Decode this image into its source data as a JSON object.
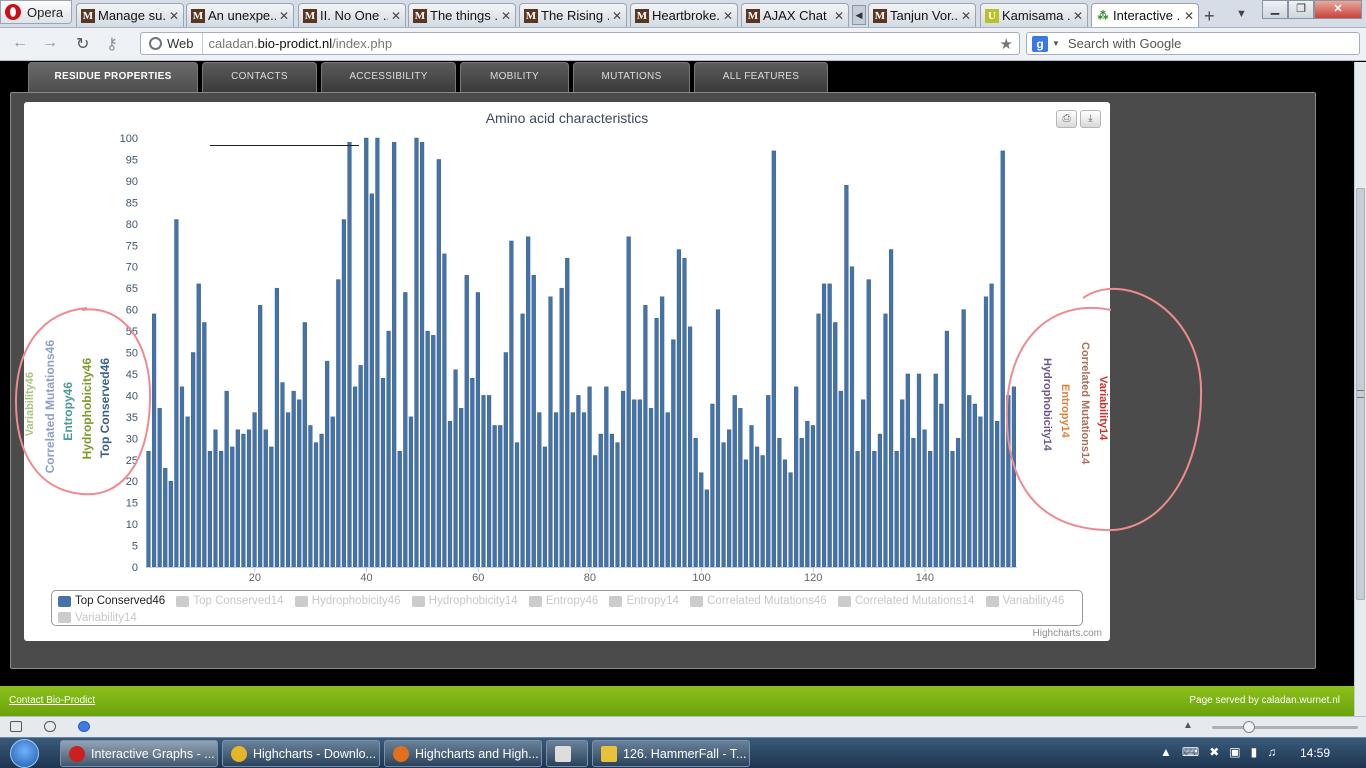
{
  "browser": {
    "opera_label": "Opera",
    "tabs": [
      {
        "title": "Manage su...",
        "icon": "m"
      },
      {
        "title": "An unexpe...",
        "icon": "m"
      },
      {
        "title": "II. No One ...",
        "icon": "m"
      },
      {
        "title": "The things ...",
        "icon": "m"
      },
      {
        "title": "The Rising ...",
        "icon": "m"
      },
      {
        "title": "Heartbroke...",
        "icon": "m"
      },
      {
        "title": "AJAX Chat",
        "icon": "m"
      },
      {
        "title": "Tanjun Vor...",
        "icon": "m"
      },
      {
        "title": "Kamisama ...",
        "icon": "u"
      },
      {
        "title": "Interactive ...",
        "icon": "g"
      }
    ],
    "web_label": "Web",
    "url_prefix": "caladan.",
    "url_domain": "bio-prodict.nl",
    "url_path": "/index.php",
    "search_placeholder": "Search with Google",
    "search_engine_letter": "g"
  },
  "nav_tabs": [
    "RESIDUE PROPERTIES",
    "CONTACTS",
    "ACCESSIBILITY",
    "MOBILITY",
    "MUTATIONS",
    "ALL FEATURES"
  ],
  "active_tab": "RESIDUE PROPERTIES",
  "chart_data": {
    "type": "bar",
    "title": "Amino acid characteristics",
    "xlabel": "",
    "ylabel": "",
    "ylim": [
      0,
      100
    ],
    "yticks": [
      0,
      5,
      10,
      15,
      20,
      25,
      30,
      35,
      40,
      45,
      50,
      55,
      60,
      65,
      70,
      75,
      80,
      85,
      90,
      95,
      100
    ],
    "xticks": [
      20,
      40,
      60,
      80,
      100,
      120,
      140
    ],
    "x_start": 1,
    "series": [
      {
        "name": "Top Conserved46",
        "color": "#4572a7",
        "values": [
          27,
          59,
          37,
          23,
          20,
          81,
          42,
          35,
          50,
          66,
          57,
          27,
          32,
          27,
          41,
          28,
          32,
          31,
          32,
          36,
          61,
          32,
          28,
          65,
          43,
          36,
          41,
          39,
          57,
          33,
          29,
          31,
          48,
          35,
          67,
          81,
          99,
          42,
          47,
          100,
          87,
          100,
          44,
          55,
          99,
          27,
          64,
          35,
          100,
          99,
          55,
          54,
          95,
          73,
          34,
          46,
          37,
          68,
          44,
          64,
          40,
          40,
          33,
          33,
          50,
          76,
          29,
          59,
          77,
          68,
          36,
          28,
          63,
          36,
          65,
          72,
          36,
          40,
          36,
          42,
          26,
          31,
          42,
          31,
          29,
          41,
          77,
          39,
          39,
          61,
          37,
          58,
          63,
          36,
          53,
          74,
          72,
          56,
          30,
          22,
          18,
          38,
          60,
          29,
          32,
          40,
          37,
          25,
          33,
          28,
          26,
          40,
          97,
          30,
          25,
          22,
          42,
          30,
          34,
          33,
          59,
          66,
          66,
          57,
          41,
          89,
          70,
          27,
          39,
          67,
          27,
          31,
          59,
          74,
          27,
          39,
          45,
          30,
          45,
          32,
          27,
          45,
          38,
          55,
          27,
          30,
          60,
          40,
          38,
          35,
          63,
          66,
          34,
          97,
          40,
          42
        ]
      },
      {
        "name": "Top Conserved14",
        "visible": false
      },
      {
        "name": "Hydrophobicity46",
        "visible": false
      },
      {
        "name": "Hydrophobicity14",
        "visible": false
      },
      {
        "name": "Entropy46",
        "visible": false
      },
      {
        "name": "Entropy14",
        "visible": false
      },
      {
        "name": "Correlated Mutations46",
        "visible": false
      },
      {
        "name": "Correlated Mutations14",
        "visible": false
      },
      {
        "name": "Variability46",
        "visible": false
      },
      {
        "name": "Variability14",
        "visible": false
      }
    ]
  },
  "left_axis_labels": [
    {
      "text": "Variability46",
      "color": "#a8c480"
    },
    {
      "text": "Correlated Mutations46",
      "color": "#8ea0c8"
    },
    {
      "text": "Entropy46",
      "color": "#4a9a9a"
    },
    {
      "text": "Hydrophobicity46",
      "color": "#7a9a2a"
    },
    {
      "text": "Top Conserved46",
      "color": "#3b5f8e"
    }
  ],
  "right_axis_labels": [
    {
      "text": "Hydrophobicity14",
      "color": "#6a5a8a"
    },
    {
      "text": "Entropy14",
      "color": "#e0803a"
    },
    {
      "text": "Correlated Mutations14",
      "color": "#a8705a"
    },
    {
      "text": "Variability14",
      "color": "#d0302a"
    }
  ],
  "credits": "Highcharts.com",
  "footer": {
    "contact_link": "Contact Bio-Prodict",
    "served_by": "Page served by  caladan.wurnet.nl"
  },
  "taskbar": {
    "tasks": [
      {
        "label": "Interactive Graphs - ...",
        "icon_color": "#cc1f1f"
      },
      {
        "label": "Highcharts - Downlo...",
        "icon_color": "#e5b52a"
      },
      {
        "label": "Highcharts and High...",
        "icon_color": "#e0701e"
      },
      {
        "label": "",
        "icon_color": "#dddddd"
      },
      {
        "label": "126. HammerFall - T...",
        "icon_color": "#e8c23a"
      }
    ],
    "clock": "14:59"
  }
}
